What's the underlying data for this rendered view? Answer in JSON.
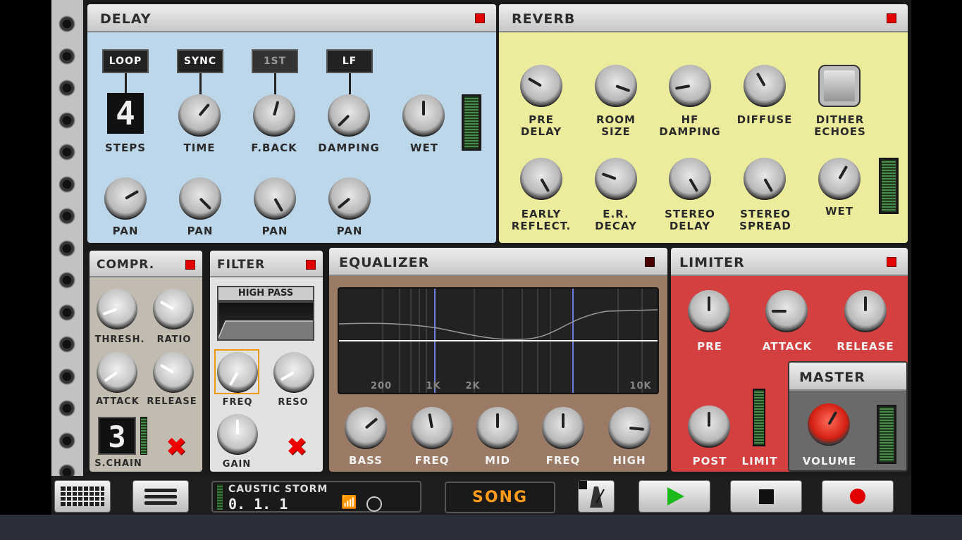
{
  "delay": {
    "title": "DELAY",
    "buttons": [
      "LOOP",
      "SYNC",
      "1ST",
      "LF"
    ],
    "steps_value": "4",
    "labels_row1": [
      "STEPS",
      "TIME",
      "F.BACK",
      "DAMPING",
      "WET"
    ],
    "labels_row2": [
      "PAN",
      "PAN",
      "PAN",
      "PAN"
    ]
  },
  "reverb": {
    "title": "REVERB",
    "labels_row1": [
      "PRE\nDELAY",
      "ROOM\nSIZE",
      "HF\nDAMPING",
      "DIFFUSE",
      "DITHER\nECHOES"
    ],
    "labels_row2": [
      "EARLY\nREFLECT.",
      "E.R.\nDECAY",
      "STEREO\nDELAY",
      "STEREO\nSPREAD",
      "WET"
    ]
  },
  "compr": {
    "title": "COMPR.",
    "labels": [
      "THRESH.",
      "RATIO",
      "ATTACK",
      "RELEASE"
    ],
    "chain_value": "3",
    "chain_label": "S.CHAIN"
  },
  "filter": {
    "title": "FILTER",
    "mode": "HIGH PASS",
    "labels": [
      "FREQ",
      "RESO",
      "GAIN"
    ]
  },
  "equalizer": {
    "title": "EQUALIZER",
    "freq_labels": [
      "200",
      "1K",
      "2K",
      "10K"
    ],
    "labels": [
      "BASS",
      "FREQ",
      "MID",
      "FREQ",
      "HIGH"
    ]
  },
  "limiter": {
    "title": "LIMITER",
    "labels": [
      "PRE",
      "ATTACK",
      "RELEASE",
      "POST",
      "LIMIT"
    ]
  },
  "master": {
    "title": "MASTER",
    "volume_label": "VOLUME"
  },
  "transport": {
    "song_name": "CAUSTIC STORM",
    "position": "0. 1. 1",
    "mode": "SONG"
  },
  "colors": {
    "delay_bg": "#bcd6ea",
    "reverb_bg": "#ecec9c",
    "compr_bg": "#c2bcb0",
    "eq_bg": "#9c7b66",
    "limiter_bg": "#d44040",
    "song_text": "#ff9c1c",
    "play": "#1cb81c",
    "record": "#e00000"
  }
}
